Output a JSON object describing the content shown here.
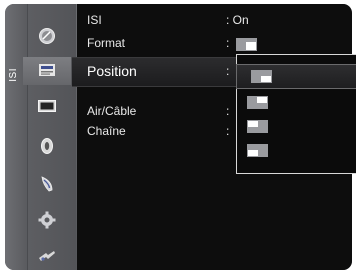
{
  "sidebar": {
    "label": "ISI"
  },
  "menu": {
    "items": [
      {
        "label": "ISI",
        "value": ": On"
      },
      {
        "label": "Format",
        "value": ":"
      },
      {
        "label": "Position",
        "value": ":"
      },
      {
        "label": "Air/Câble",
        "value": ":"
      },
      {
        "label": "Chaîne",
        "value": ":"
      }
    ]
  },
  "icons": [
    "picture-icon",
    "sound-icon",
    "channel-icon",
    "setup-icon",
    "input-icon",
    "application-icon",
    "support-icon"
  ],
  "position_options": [
    {
      "name": "bottom-right",
      "selected": true
    },
    {
      "name": "top-right",
      "selected": false
    },
    {
      "name": "top-left",
      "selected": false
    },
    {
      "name": "bottom-left",
      "selected": false
    }
  ],
  "colors": {
    "panel": "#0d0d0d",
    "frame": "#616266",
    "popup_border": "#d8d8d8"
  }
}
